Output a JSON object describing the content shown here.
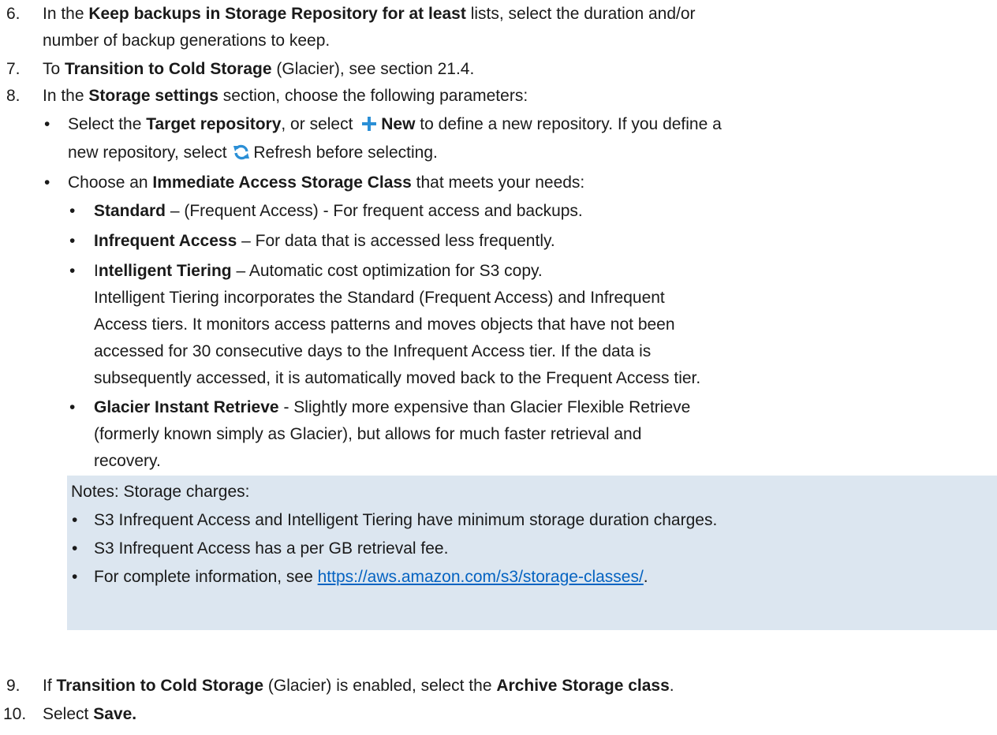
{
  "steps": {
    "s6": {
      "num": "6.",
      "pre": "In the ",
      "bold1": "Keep backups in Storage Repository for at least",
      "post": " lists, select the duration and/or",
      "cont": "number of backup generations to keep."
    },
    "s7": {
      "num": "7.",
      "pre": "To ",
      "bold1": "Transition to Cold Storage",
      "post": " (Glacier), see section 21.4."
    },
    "s8": {
      "num": "8.",
      "pre": "In the ",
      "bold1": "Storage settings",
      "post": " section, choose the following parameters:"
    },
    "s9": {
      "num": "9.",
      "pre": "If ",
      "bold1": "Transition to Cold Storage",
      "mid": " (Glacier) is enabled, select the ",
      "bold2": "Archive Storage class",
      "post": "."
    },
    "s10": {
      "num": "10.",
      "pre": "Select ",
      "bold1": "Save."
    }
  },
  "bullets": {
    "target": {
      "pre": "Select the ",
      "bold1": "Target repository",
      "mid": ", or select ",
      "bold2": "New",
      "post": " to define a new repository. If you define a",
      "cont_pre": "new repository, select",
      "cont_post": "Refresh before selecting."
    },
    "class": {
      "pre": "Choose an ",
      "bold1": "Immediate Access Storage Class",
      "post": " that meets your needs:"
    },
    "standard": {
      "bold1": "Standard",
      "post": " – (Frequent Access) - For frequent access and backups."
    },
    "infrequent": {
      "bold1": "Infrequent Access",
      "post": " – For data that is accessed less frequently."
    },
    "intelligent": {
      "pre": "I",
      "bold1": "ntelligent Tiering",
      "post": " – Automatic cost optimization for S3 copy.",
      "lines": [
        "Intelligent Tiering incorporates the Standard (Frequent Access) and Infrequent",
        "Access tiers. It monitors access patterns and moves objects that have not been",
        "accessed for 30 consecutive days to the Infrequent Access tier. If the data is",
        "subsequently accessed, it is automatically moved back to the Frequent Access tier."
      ]
    },
    "glacier": {
      "bold1": "Glacier Instant Retrieve",
      "post": " - Slightly more expensive than Glacier Flexible Retrieve",
      "lines": [
        "(formerly known simply as Glacier), but allows for much faster retrieval and",
        "recovery."
      ]
    }
  },
  "notes": {
    "heading": "Notes:  Storage charges:",
    "items": [
      "S3 Infrequent Access and Intelligent Tiering have minimum storage duration charges.",
      "S3 Infrequent Access has a per GB retrieval fee."
    ],
    "link_pre": "For complete information, see ",
    "link_text": "https://aws.amazon.com/s3/storage-classes/",
    "link_post": "."
  },
  "colors": {
    "note_bg": "#dce6f0",
    "link": "#0563c1",
    "icon_blue": "#2b8fd6"
  },
  "icons": {
    "plus": "plus-icon",
    "refresh": "refresh-icon"
  }
}
